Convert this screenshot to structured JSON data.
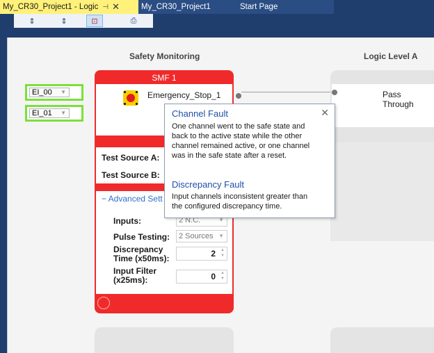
{
  "tabs": [
    {
      "label": "My_CR30_Project1 - Logic",
      "pin": "⊣",
      "close": "✕"
    },
    {
      "label": "My_CR30_Project1"
    },
    {
      "label": "Start Page"
    }
  ],
  "toolbar": {
    "icons": [
      "expand-all-icon",
      "collapse-icon",
      "fit-view-icon",
      "print-icon"
    ],
    "glyphs": [
      "⇕",
      "⇕",
      "⊡",
      "⎙"
    ]
  },
  "columns": {
    "left": "Safety Monitoring",
    "right": "Logic Level A"
  },
  "inputs": [
    {
      "label": "EI_00"
    },
    {
      "label": "EI_01"
    }
  ],
  "smf": {
    "title": "SMF 1",
    "function_name": "Emergency_Stop_1",
    "test_source_a": "Test Source A:",
    "test_source_b": "Test Source B:",
    "advanced_label": "− Advanced Sett",
    "inputs_label": "Inputs:",
    "inputs_value": "2 N.C.",
    "pulse_label": "Pulse Testing:",
    "pulse_value": "2 Sources",
    "discrepancy_label_1": "Discrepancy",
    "discrepancy_label_2": "Time (x50ms):",
    "discrepancy_value": "2",
    "filter_label_1": "Input Filter",
    "filter_label_2": "(x25ms):",
    "filter_value": "0"
  },
  "logic": {
    "pass_through": "Pass Through"
  },
  "tooltip": {
    "close": "✕",
    "channel_fault_title": "Channel Fault",
    "channel_fault_lines": [
      "One channel went to the safe state and",
      "back to the active state while the other",
      "channel remained active, or one channel",
      "was in the safe state after a reset."
    ],
    "discrepancy_fault_title": "Discrepancy Fault",
    "discrepancy_fault_lines": [
      "Input channels inconsistent greater than",
      "the configured discrepancy time."
    ]
  },
  "colors": {
    "accent_red": "#f02a2a",
    "input_green": "#7be03a",
    "tab_active": "#fff17a",
    "frame_blue": "#1f3e6e"
  }
}
